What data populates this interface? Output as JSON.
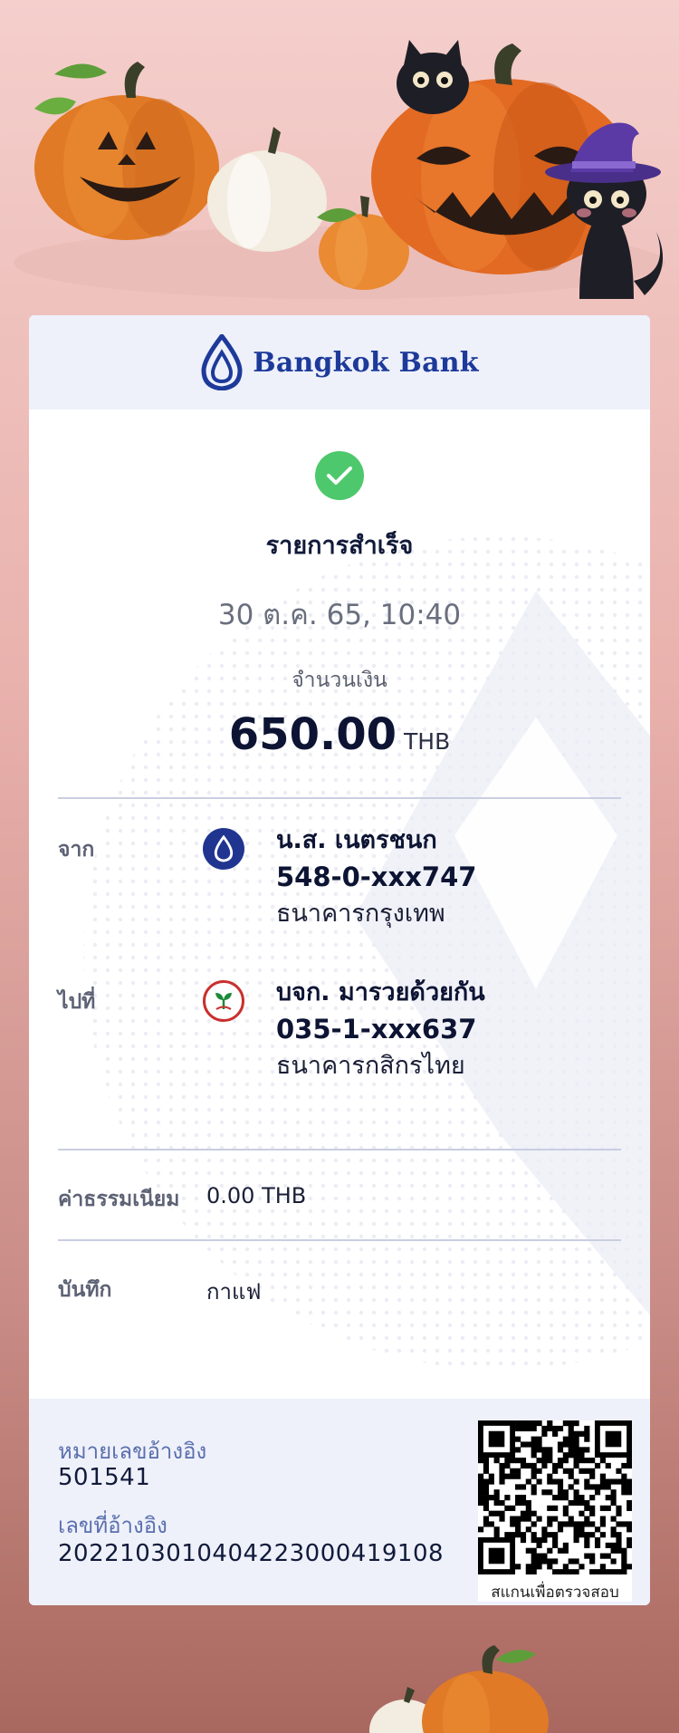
{
  "brand": {
    "name": "Bangkok Bank",
    "color": "#1d3a9a"
  },
  "status": {
    "title": "รายการสำเร็จ",
    "icon": "check-icon",
    "color": "#4ec86c"
  },
  "datetime": "30 ต.ค. 65, 10:40",
  "amount": {
    "label": "จำนวนเงิน",
    "value": "650.00",
    "currency": "THB"
  },
  "from": {
    "label": "จาก",
    "name": "น.ส. เนตรชนก",
    "account": "548-0-xxx747",
    "bank": "ธนาคารกรุงเทพ",
    "logo_icon": "bangkok-bank-logo-icon"
  },
  "to": {
    "label": "ไปที่",
    "name": "บจก. มารวยด้วยกัน",
    "account": "035-1-xxx637",
    "bank": "ธนาคารกสิกรไทย",
    "logo_icon": "kasikorn-bank-logo-icon"
  },
  "fee": {
    "label": "ค่าธรรมเนียม",
    "value": "0.00 THB"
  },
  "memo": {
    "label": "บันทึก",
    "value": "กาแฟ"
  },
  "reference": {
    "ref_no_label": "หมายเลขอ้างอิง",
    "ref_no": "501541",
    "txn_ref_label": "เลขที่อ้างอิง",
    "txn_ref": "2022103010404223000419108"
  },
  "qr": {
    "caption": "สแกนเพื่อตรวจสอบ",
    "icon": "qr-code-icon"
  }
}
